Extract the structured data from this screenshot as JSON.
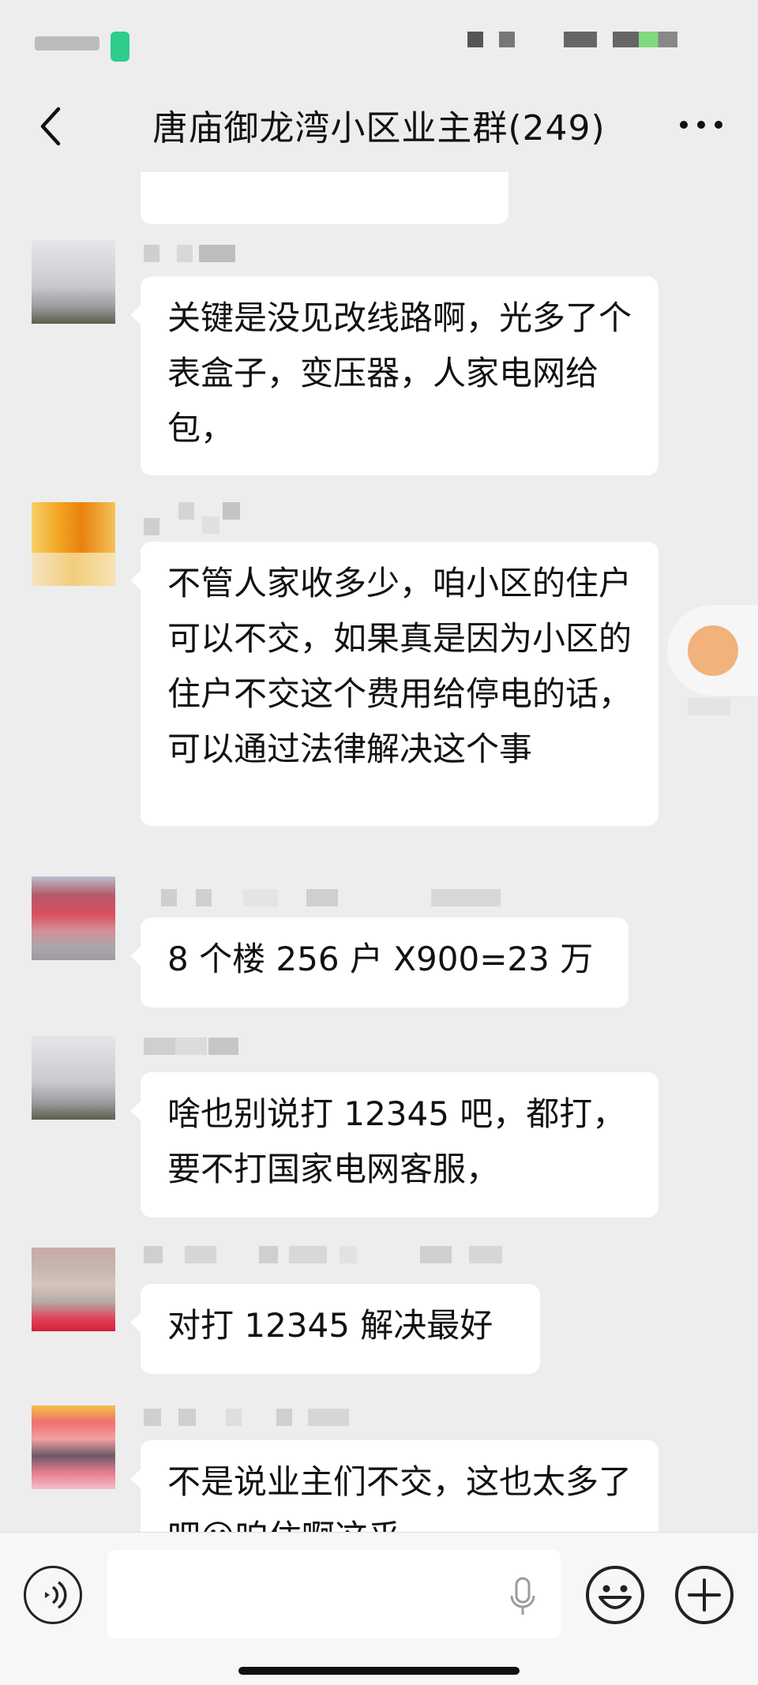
{
  "header": {
    "title": "唐庙御龙湾小区业主群(249)"
  },
  "messages": [
    {
      "id": 1,
      "text": "关键是没见改线路啊，光多了个表盒子，变压器，人家电网给包，"
    },
    {
      "id": 2,
      "text": "不管人家收多少，咱小区的住户可以不交，如果真是因为小区的住户不交这个费用给停电的话，可以通过法律解决这个事"
    },
    {
      "id": 3,
      "text": "8 个楼 256 户 X900=23 万"
    },
    {
      "id": 4,
      "text": "啥也别说打 12345 吧，都打，要不打国家电网客服，"
    },
    {
      "id": 5,
      "text": "对打 12345 解决最好"
    },
    {
      "id": 6,
      "text": "不是说业主们不交，这也太多了吧😮咱住啊这乎"
    }
  ],
  "icons": {
    "back": "chevron-left-icon",
    "more": "more-dots-icon",
    "voice": "voice-icon",
    "mic": "mic-icon",
    "emoji": "emoji-icon",
    "plus": "plus-icon"
  },
  "colors": {
    "background": "#ededed",
    "bubble": "#ffffff",
    "text": "#111111"
  }
}
